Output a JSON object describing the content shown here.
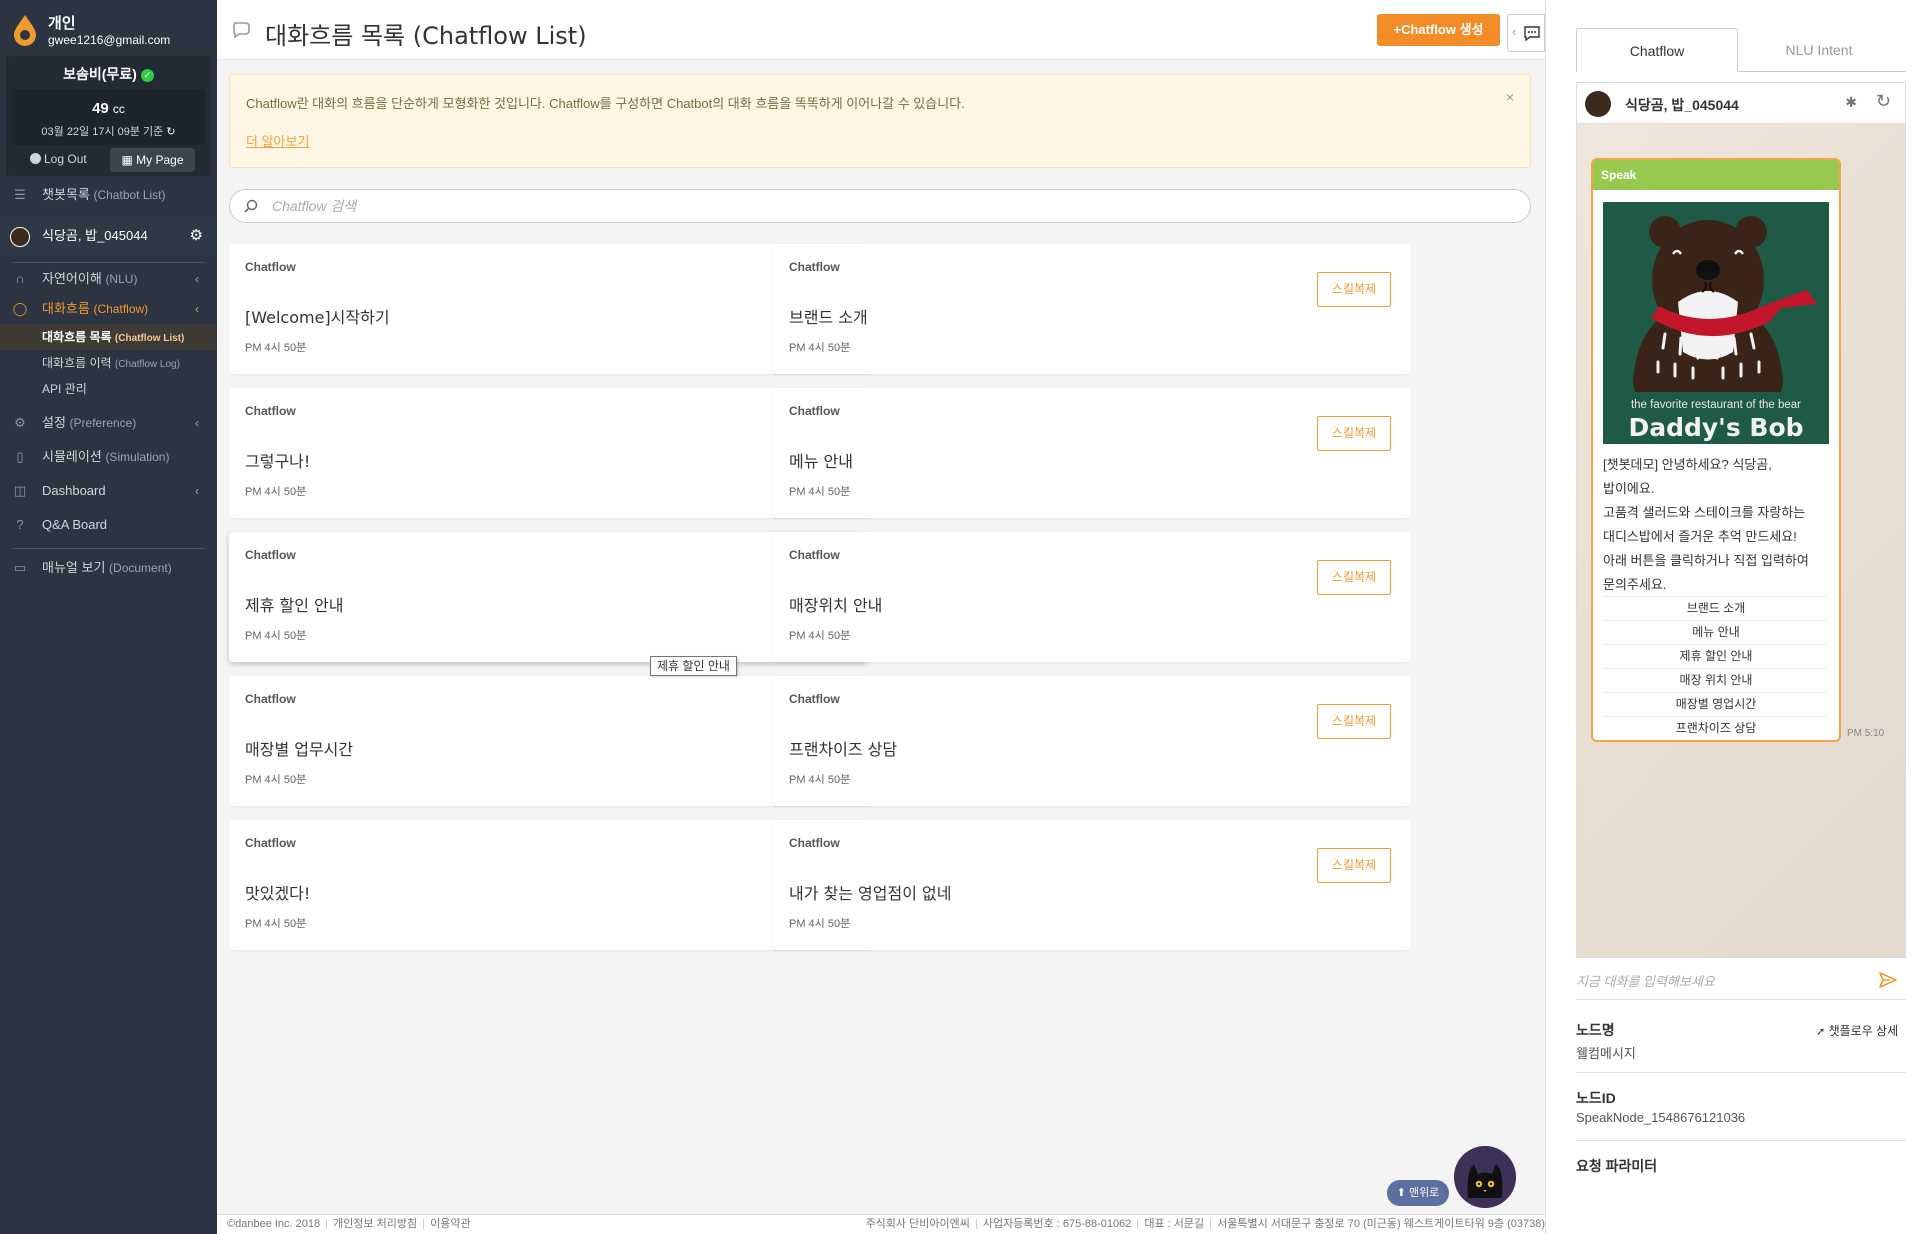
{
  "user": {
    "name": "개인",
    "email": "gwee1216@gmail.com",
    "plan": "보솜비(무료)",
    "cc_value": "49",
    "cc_unit": "cc",
    "cc_date": "03월 22일 17시 09분 기준",
    "logout_label": "Log Out",
    "mypage_label": "My Page"
  },
  "sidebar": {
    "chatbot_list": {
      "ko": "챗봇목록",
      "en": "(Chatbot List)"
    },
    "bot_name": "식당곰, 밥_045044",
    "nlu": {
      "ko": "자연어이해",
      "en": "(NLU)"
    },
    "chatflow": {
      "ko": "대화흐름",
      "en": "(Chatflow)"
    },
    "chatflow_list": {
      "ko": "대화흐름 목록",
      "en": "(Chatflow List)"
    },
    "chatflow_log": {
      "ko": "대화흐름 이력",
      "en": "(Chatflow Log)"
    },
    "api": "API 관리",
    "preference": {
      "ko": "설정",
      "en": "(Preference)"
    },
    "simulation": {
      "ko": "시뮬레이션",
      "en": "(Simulation)"
    },
    "dashboard": "Dashboard",
    "qa_board": "Q&A Board",
    "document": {
      "ko": "매뉴얼 보기",
      "en": "(Document)"
    }
  },
  "header": {
    "title": "대화흐름 목록 (Chatflow List)",
    "create_label": "+Chatflow 생성"
  },
  "notice": {
    "text": "Chatflow란 대화의 흐름을 단순하게 모형화한 것입니다. Chatflow를 구성하면 Chatbot의 대화 흐름을 똑똑하게 이어나갈 수 있습니다.",
    "link": "더 알아보기",
    "close": "×"
  },
  "search": {
    "placeholder": "Chatflow 검색"
  },
  "cards": [
    {
      "label": "Chatflow",
      "title": "[Welcome]시작하기",
      "time": "PM 4시 50분",
      "button": "스킬복제"
    },
    {
      "label": "Chatflow",
      "title": "브랜드 소개",
      "time": "PM 4시 50분",
      "button": "스킬복제"
    },
    {
      "label": "Chatflow",
      "title": "그렇구나!",
      "time": "PM 4시 50분",
      "button": "스킬복제"
    },
    {
      "label": "Chatflow",
      "title": "메뉴 안내",
      "time": "PM 4시 50분",
      "button": "스킬복제"
    },
    {
      "label": "Chatflow",
      "title": "제휴 할인 안내",
      "time": "PM 4시 50분",
      "button": "스킬복제"
    },
    {
      "label": "Chatflow",
      "title": "매장위치 안내",
      "time": "PM 4시 50분",
      "button": "스킬복제"
    },
    {
      "label": "Chatflow",
      "title": "매장별 업무시간",
      "time": "PM 4시 50분",
      "button": "스킬복제"
    },
    {
      "label": "Chatflow",
      "title": "프랜차이즈 상담",
      "time": "PM 4시 50분",
      "button": "스킬복제"
    },
    {
      "label": "Chatflow",
      "title": "맛있겠다!",
      "time": "PM 4시 50분",
      "button": "스킬복제"
    },
    {
      "label": "Chatflow",
      "title": "내가 찾는 영업점이 없네",
      "time": "PM 4시 50분",
      "button": "스킬복제"
    }
  ],
  "tooltip": "제휴 할인 안내",
  "footer": {
    "copyright": "©danbee Inc. 2018",
    "privacy": "개인정보 처리방침",
    "terms": "이용약관",
    "company": "주식회사 단비아이엔씨",
    "biz_no": "사업자등록번호 : 675-88-01062",
    "ceo": "대표 : 서문길",
    "address": "서울특별시 서대문구 충정로 70 (미근동) 웨스트게이트타워 9층 (03738)"
  },
  "to_top": "⬆ 맨위로",
  "panel": {
    "tab_chatflow": "Chatflow",
    "tab_nlu": "NLU Intent",
    "bot_name": "식당곰, 밥_045044",
    "speak_label": "Speak",
    "img_caption": "the favorite restaurant of the bear",
    "img_brand": "Daddy's Bob",
    "message_lines": [
      "[챗봇데모] 안녕하세요? 식당곰,",
      "밥이에요.",
      "고품격 샐러드와 스테이크를 자랑하는",
      "대디스밥에서 즐거운 추억 만드세요!",
      "아래 버튼을 클릭하거나 직접 입력하여",
      "문의주세요."
    ],
    "quick_replies": [
      "브랜드 소개",
      "메뉴 안내",
      "제휴 할인 안내",
      "매장 위치 안내",
      "매장별 영업시간",
      "프랜차이즈 상담"
    ],
    "message_time": "PM 5:10",
    "input_placeholder": "지금 대화를 입력해보세요",
    "node_name_label": "노드명",
    "node_name_value": "웰컴메시지",
    "detail_link": "챗플로우 상세",
    "node_id_label": "노드ID",
    "node_id_value": "SpeakNode_1548676121036",
    "request_param_label": "요청 파라미터"
  },
  "colors": {
    "sidebar_bg": "#2b3440",
    "accent_orange": "#f28c28",
    "speak_green": "#97c94f",
    "notice_bg": "#fdf6e2"
  }
}
